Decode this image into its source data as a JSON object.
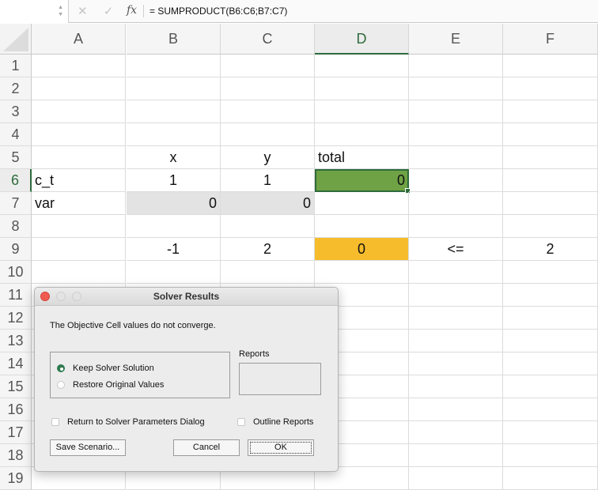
{
  "formula_bar": {
    "name_box": "",
    "cancel_icon": "✕",
    "enter_icon": "✓",
    "fx_label": "fx",
    "formula": "= SUMPRODUCT(B6:C6;B7:C7)"
  },
  "columns": [
    "A",
    "B",
    "C",
    "D",
    "E",
    "F"
  ],
  "active_column": "D",
  "rows": [
    "1",
    "2",
    "3",
    "4",
    "5",
    "6",
    "7",
    "8",
    "9",
    "10",
    "11",
    "12",
    "13",
    "14",
    "15",
    "16",
    "17",
    "18",
    "19"
  ],
  "active_row": "6",
  "cells": {
    "B5": "x",
    "C5": "y",
    "D5": "total",
    "A6": "c_t",
    "B6": "1",
    "C6": "1",
    "D6": "0",
    "A7": "var",
    "B7": "0",
    "C7": "0",
    "B9": "-1",
    "C9": "2",
    "D9": "0",
    "E9": "<=",
    "F9": "2"
  },
  "colors": {
    "objective_fill": "#6fa244",
    "constraint_fill": "#f6bc2c",
    "variable_fill": "#e3e3e3",
    "selection": "#2e6b3c"
  },
  "dialog": {
    "title": "Solver Results",
    "message": "The Objective Cell values do not converge.",
    "radio_keep": "Keep Solver Solution",
    "radio_restore": "Restore Original Values",
    "selected_radio": "keep",
    "reports_label": "Reports",
    "return_checkbox": "Return to Solver Parameters Dialog",
    "outline_checkbox": "Outline Reports",
    "save_button": "Save Scenario...",
    "cancel_button": "Cancel",
    "ok_button": "OK"
  }
}
